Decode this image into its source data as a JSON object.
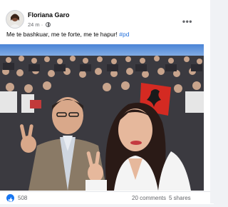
{
  "post": {
    "author": "Floriana Garo",
    "time": "24 m",
    "separator": "·",
    "text": "Me te bashkuar, me te forte, me te hapur!",
    "hashtag": "#pd"
  },
  "icons": {
    "more": "more-options-icon",
    "audience": "globe-icon",
    "reaction": "like-icon"
  },
  "footer": {
    "reactions_count": "508",
    "comments": "20 comments",
    "shares": "5 shares"
  },
  "colors": {
    "link": "#216fdb",
    "like_blue": "#1877f2",
    "meta_text": "#65676b",
    "flag_red": "#d42a22"
  }
}
